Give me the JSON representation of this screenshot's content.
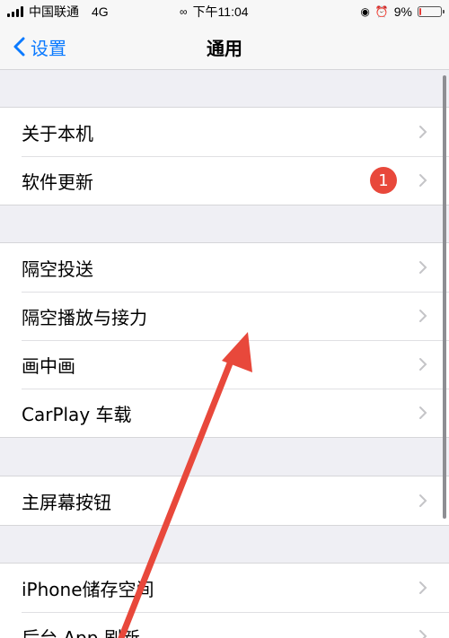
{
  "status_bar": {
    "carrier": "中国联通",
    "network": "4G",
    "time": "下午11:04",
    "battery": "9%",
    "battery_level": 0.09,
    "battery_color": "#e53935"
  },
  "nav": {
    "back_label": "设置",
    "title": "通用",
    "accent_color": "#0a7aff"
  },
  "groups": [
    {
      "items": [
        {
          "label": "关于本机"
        },
        {
          "label": "软件更新",
          "badge": "1"
        }
      ]
    },
    {
      "items": [
        {
          "label": "隔空投送"
        },
        {
          "label": "隔空播放与接力"
        },
        {
          "label": "画中画"
        },
        {
          "label": "CarPlay 车载"
        }
      ]
    },
    {
      "items": [
        {
          "label": "主屏幕按钮"
        }
      ]
    },
    {
      "items": [
        {
          "label": "iPhone储存空间"
        },
        {
          "label": "后台 App 刷新"
        }
      ]
    }
  ],
  "annotation": {
    "arrow_color": "#e8483b"
  }
}
